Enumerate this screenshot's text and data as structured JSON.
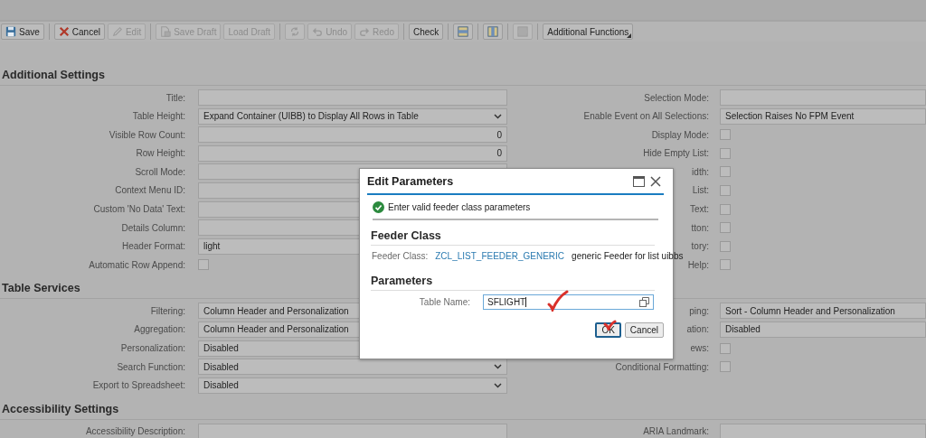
{
  "toolbar": [
    {
      "kind": "save",
      "label": "Save",
      "disabled": false
    },
    {
      "kind": "separator"
    },
    {
      "kind": "cancel",
      "label": "Cancel",
      "disabled": false
    },
    {
      "kind": "edit",
      "label": "Edit",
      "disabled": true
    },
    {
      "kind": "separator"
    },
    {
      "kind": "save-draft",
      "label": "Save Draft",
      "disabled": true
    },
    {
      "kind": "plain",
      "label": "Load Draft",
      "disabled": true
    },
    {
      "kind": "separator"
    },
    {
      "kind": "refresh",
      "disabled": true
    },
    {
      "kind": "undo",
      "label": "Undo",
      "disabled": true
    },
    {
      "kind": "redo",
      "label": "Redo",
      "disabled": true
    },
    {
      "kind": "separator"
    },
    {
      "kind": "plain",
      "label": "Check",
      "disabled": false
    },
    {
      "kind": "separator"
    },
    {
      "kind": "layout-rows",
      "disabled": false
    },
    {
      "kind": "separator"
    },
    {
      "kind": "layout-columns",
      "disabled": false
    },
    {
      "kind": "separator"
    },
    {
      "kind": "layout-rows",
      "disabled": true
    },
    {
      "kind": "separator"
    },
    {
      "kind": "menu",
      "label": "Additional Functions",
      "disabled": false
    }
  ],
  "sections": [
    {
      "title": "Additional Settings",
      "rows": [
        {
          "left": {
            "label": "Title:",
            "kind": "input"
          },
          "right": {
            "label": "Selection Mode:",
            "kind": "input"
          }
        },
        {
          "left": {
            "label": "Table Height:",
            "kind": "select",
            "value": "Expand Container (UIBB) to Display All Rows in Table"
          },
          "right": {
            "label": "Enable Event on All Selections:",
            "kind": "input",
            "value": "Selection Raises No FPM Event"
          }
        },
        {
          "left": {
            "label": "Visible Row Count:",
            "kind": "number",
            "value": "0"
          },
          "right": {
            "label": "Display Mode:",
            "kind": "checkbox",
            "checked": false
          }
        },
        {
          "left": {
            "label": "Row Height:",
            "kind": "number",
            "value": "0"
          },
          "right": {
            "label": "Hide Empty List:",
            "kind": "checkbox",
            "checked": false
          }
        },
        {
          "left": {
            "label": "Scroll Mode:",
            "kind": "input"
          },
          "right": {
            "label": "idth:",
            "kind": "checkbox",
            "checked": false
          }
        },
        {
          "left": {
            "label": "Context Menu ID:",
            "kind": "input"
          },
          "right": {
            "label": "List:",
            "kind": "checkbox",
            "checked": false
          }
        },
        {
          "left": {
            "label": "Custom 'No Data' Text:",
            "kind": "input"
          },
          "right": {
            "label": "Text:",
            "kind": "checkbox",
            "checked": false
          }
        },
        {
          "left": {
            "label": "Details Column:",
            "kind": "input"
          },
          "right": {
            "label": "tton:",
            "kind": "checkbox",
            "checked": false
          }
        },
        {
          "left": {
            "label": "Header Format:",
            "kind": "input",
            "value": "light"
          },
          "right": {
            "label": "tory:",
            "kind": "checkbox",
            "checked": false
          }
        },
        {
          "left": {
            "label": "Automatic Row Append:",
            "kind": "checkbox",
            "checked": false
          },
          "right": {
            "label": "Help:",
            "kind": "checkbox",
            "checked": false
          }
        }
      ]
    },
    {
      "title": "Table Services",
      "rows": [
        {
          "left": {
            "label": "Filtering:",
            "kind": "input",
            "value": "Column Header and Personalization"
          },
          "right": {
            "label": "ping:",
            "kind": "input",
            "value": "Sort - Column Header and Personalization"
          }
        },
        {
          "left": {
            "label": "Aggregation:",
            "kind": "input",
            "value": "Column Header and Personalization"
          },
          "right": {
            "label": "ation:",
            "kind": "input",
            "value": "Disabled"
          }
        },
        {
          "left": {
            "label": "Personalization:",
            "kind": "input",
            "value": "Disabled"
          },
          "right": {
            "label": "ews:",
            "kind": "checkbox",
            "checked": false
          }
        },
        {
          "left": {
            "label": "Search Function:",
            "kind": "select",
            "value": "Disabled"
          },
          "right": {
            "label": "Conditional Formatting:",
            "kind": "checkbox",
            "checked": false
          }
        },
        {
          "left": {
            "label": "Export to Spreadsheet:",
            "kind": "select",
            "value": "Disabled"
          }
        }
      ]
    },
    {
      "title": "Accessibility Settings",
      "rows": [
        {
          "left": {
            "label": "Accessibility Description:",
            "kind": "input"
          },
          "right": {
            "label": "ARIA Landmark:",
            "kind": "input"
          }
        }
      ]
    }
  ],
  "dialog": {
    "title": "Edit Parameters",
    "message": "Enter valid feeder class parameters",
    "feeder_heading": "Feeder Class",
    "feeder_label": "Feeder Class:",
    "feeder_class": "ZCL_LIST_FEEDER_GENERIC",
    "feeder_description": "generic Feeder for list uibbs",
    "parameters_heading": "Parameters",
    "parameter_label": "Table Name:",
    "parameter_value": "SFLIGHT",
    "buttons": [
      {
        "label": "OK",
        "focused": true
      },
      {
        "label": "Cancel",
        "focused": false
      }
    ]
  }
}
